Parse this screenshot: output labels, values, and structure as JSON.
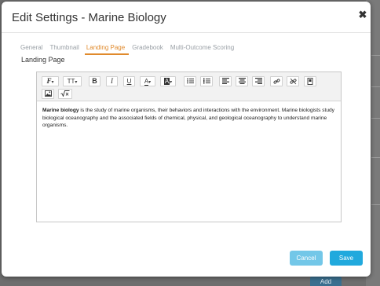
{
  "modal": {
    "title": "Edit Settings - Marine Biology",
    "close_glyph": "✖"
  },
  "tabs": [
    {
      "label": "General",
      "active": false
    },
    {
      "label": "Thumbnail",
      "active": false
    },
    {
      "label": "Landing Page",
      "active": true
    },
    {
      "label": "Gradebook",
      "active": false
    },
    {
      "label": "Multi-Outcome Scoring",
      "active": false
    }
  ],
  "section": {
    "label": "Landing Page"
  },
  "editor": {
    "toolbar": {
      "font_family_icon": "font-family-icon",
      "font_size_label": "TT",
      "bold_label": "B",
      "italic_label": "I",
      "underline_label": "U",
      "text_color_label": "A",
      "bg_color_label": "A"
    },
    "content": {
      "bold_term": "Marine biology",
      "text": " is the study of marine organisms, their behaviors and interactions with the environment. Marine biologists study biological oceanography and the associated fields of chemical, physical, and geological oceanography to understand marine organisms."
    }
  },
  "footer": {
    "cancel_label": "Cancel",
    "save_label": "Save"
  },
  "background": {
    "add_label": "Add"
  },
  "colors": {
    "accent": "#e08a2c",
    "primary_button": "#21a9dd",
    "secondary_button": "#73c7e8"
  }
}
